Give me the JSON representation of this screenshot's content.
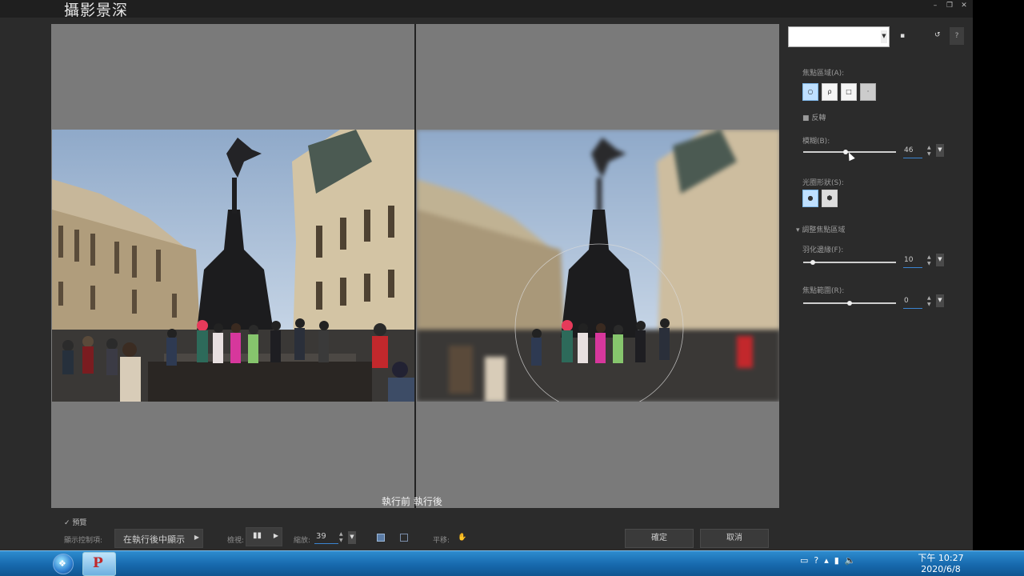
{
  "window": {
    "title": "攝影景深"
  },
  "preview": {
    "before_label": "執行前",
    "after_label": "執行後"
  },
  "bottom": {
    "preview_check": "✓ 預覽",
    "show_controls_label": "顯示控制項:",
    "show_controls_value": "在執行後中顯示",
    "view_label": "檢視:",
    "zoom_label": "縮放:",
    "zoom_value": "39",
    "pan_label": "平移:",
    "ok_button": "確定",
    "cancel_button": "取消"
  },
  "panel": {
    "focus_area_label": "焦點區域(A):",
    "invert_label": "反轉",
    "blur_label": "模糊(B):",
    "blur_value": "46",
    "blur_level": 0.46,
    "aperture_label": "光圈形狀(S):",
    "adjust_focus_label": "調整焦點區域",
    "feather_label": "羽化邊緣(F):",
    "feather_value": "10",
    "feather_level": 0.1,
    "focus_range_label": "焦點範圍(R):",
    "focus_range_value": "0",
    "focus_range_level": 0.5
  },
  "taskbar": {
    "time": "下午 10:27",
    "date": "2020/6/8"
  }
}
